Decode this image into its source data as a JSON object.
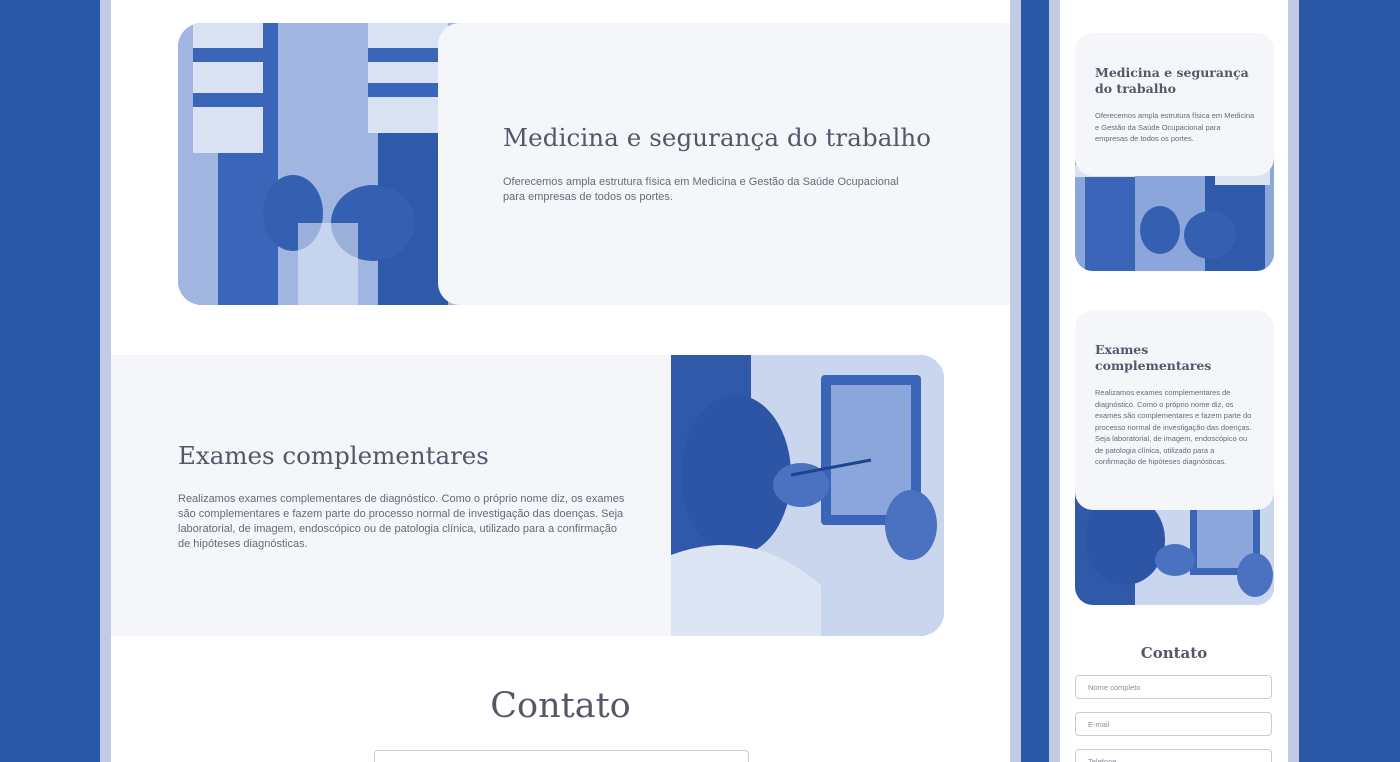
{
  "desktop": {
    "section1": {
      "title": "Medicina e segurança do trabalho",
      "text": "Oferecemos ampla estrutura física em Medicina e Gestão da Saúde Ocupacional para empresas de todos os portes."
    },
    "section2": {
      "title": "Exames complementares",
      "text": "Realizamos exames complementares de diagnóstico. Como o próprio nome diz, os exames são complementares e fazem parte do processo normal de investigação das doenças. Seja laboratorial, de imagem, endoscópico ou de patologia clínica, utilizado para a confirmação de hipóteses diagnósticas."
    },
    "contact": {
      "title": "Contato"
    }
  },
  "mobile": {
    "section1": {
      "title": "Medicina e segurança do trabalho",
      "text": "Oferecemos ampla estrutura física em Medicina e Gestão da Saúde Ocupacional para empresas de todos os portes."
    },
    "section2": {
      "title": "Exames complementares",
      "text": "Realizamos exames complementares de diagnóstico. Como o próprio nome diz, os exames são complementares e fazem parte do processo normal de investigação das doenças. Seja laboratorial, de imagem, endoscópico ou de patologia clínica, utilizado para a confirmação de hipóteses diagnósticas."
    },
    "contact": {
      "title": "Contato",
      "fields": [
        {
          "placeholder": "Nome completo"
        },
        {
          "placeholder": "E-mail"
        },
        {
          "placeholder": "Telefone"
        }
      ]
    }
  },
  "colors": {
    "background": "#2a57a6",
    "frame": "#c2cbe3",
    "card": "#f4f6f9",
    "text": "#55566a",
    "photo_tint": "#3b65b8"
  }
}
